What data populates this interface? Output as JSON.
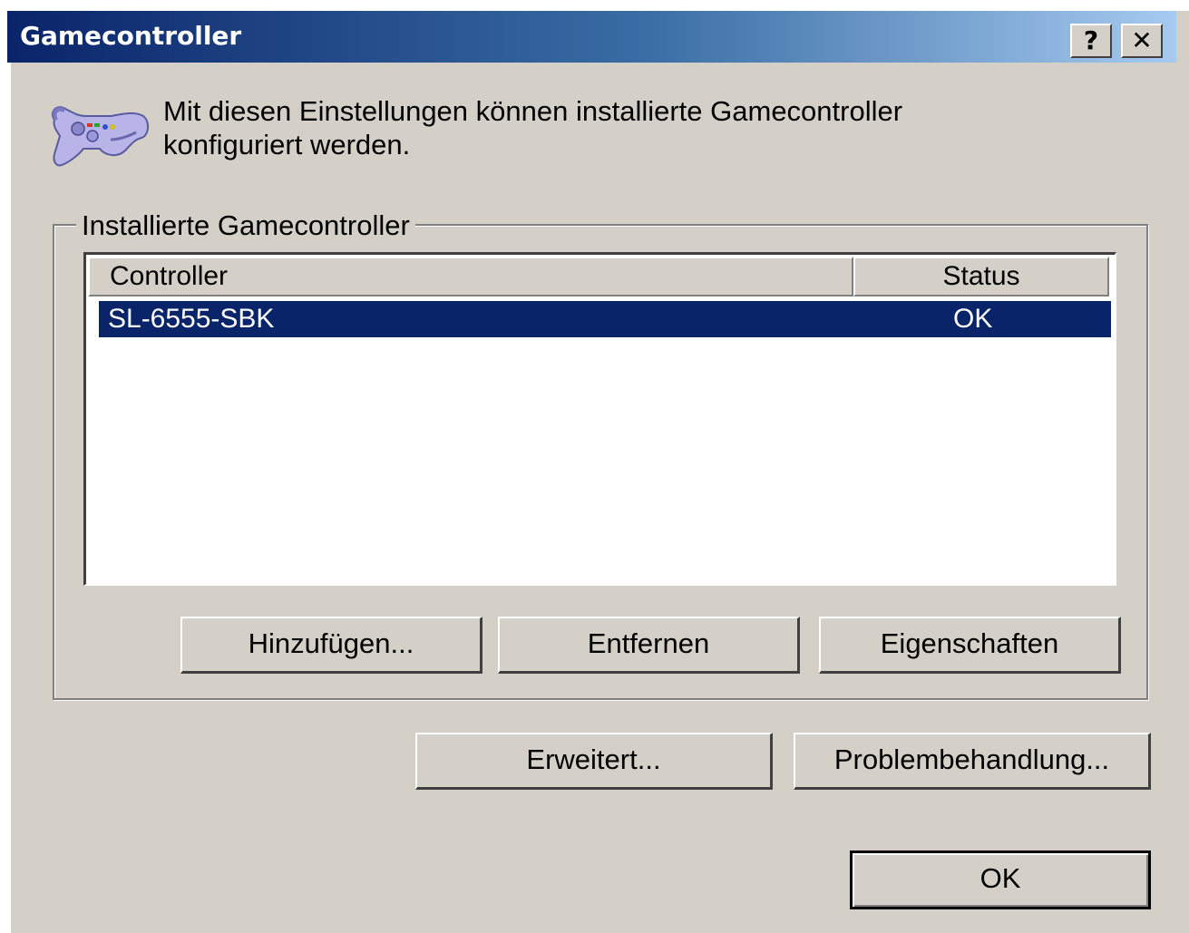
{
  "window": {
    "title": "Gamecontroller",
    "help_button": "?",
    "close_button": "✕"
  },
  "intro": {
    "line1": "Mit diesen Einstellungen können installierte Gamecontroller",
    "line2": "konfiguriert werden."
  },
  "group": {
    "title": "Installierte Gamecontroller",
    "columns": [
      "Controller",
      "Status"
    ],
    "rows": [
      {
        "controller": "SL-6555-SBK",
        "status": "OK",
        "selected": true
      }
    ],
    "buttons": {
      "add": "Hinzufügen...",
      "remove": "Entfernen",
      "properties": "Eigenschaften"
    }
  },
  "buttons": {
    "advanced": "Erweitert...",
    "troubleshoot": "Problembehandlung...",
    "ok": "OK"
  },
  "colors": {
    "dialog_background": "#d4d0c8",
    "titlebar_start": "#0a246a",
    "titlebar_end": "#a6caf0",
    "selection": "#0a246a",
    "list_background": "#ffffff"
  },
  "icons": {
    "intro_icon": "gamepad-icon"
  }
}
